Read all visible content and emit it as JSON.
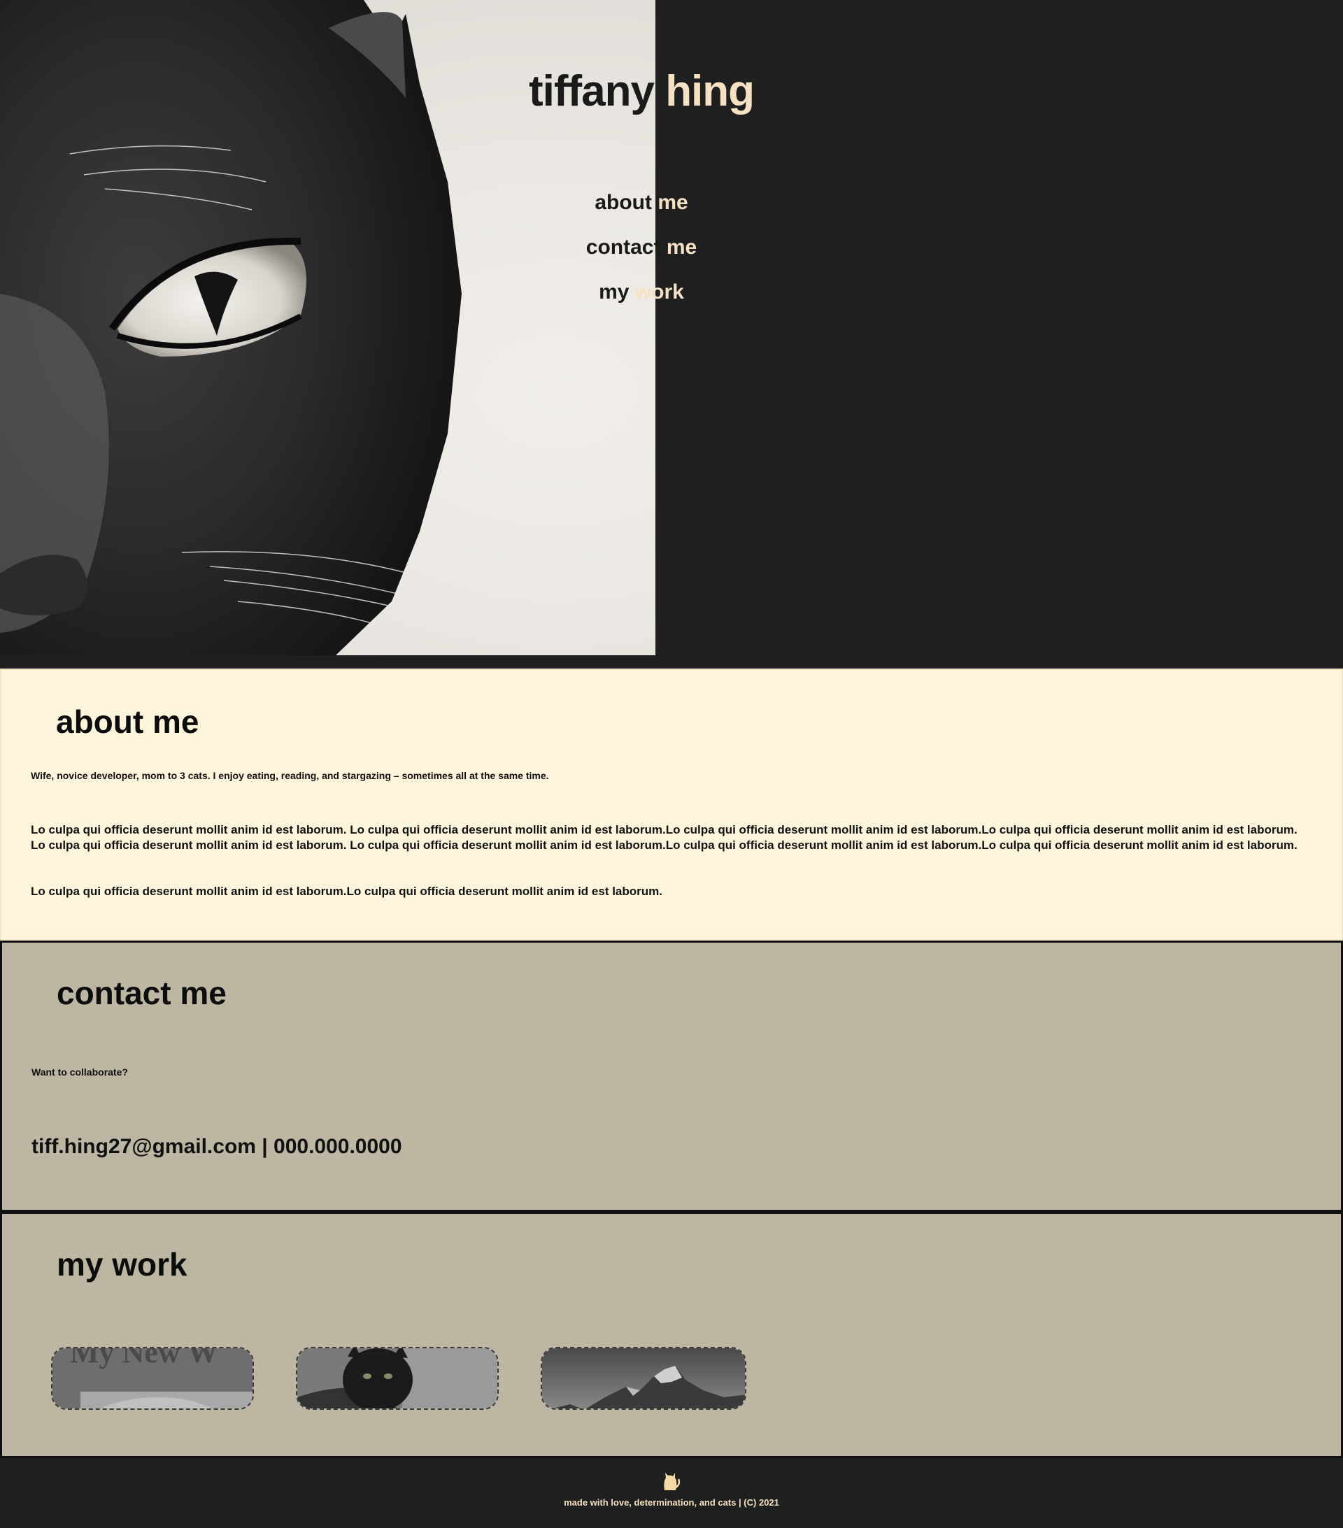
{
  "hero": {
    "title_first": "tiffany",
    "title_last": "hing",
    "nav": [
      {
        "first": "about",
        "second": "me"
      },
      {
        "first": "contact",
        "second": "me"
      },
      {
        "first": "my",
        "second": "work"
      }
    ]
  },
  "about": {
    "title": "about me",
    "intro": "Wife, novice developer, mom to 3 cats. I enjoy eating, reading, and stargazing – sometimes all at the same time.",
    "paragraph1": "Lo culpa qui officia deserunt mollit anim id est laborum. Lo culpa qui officia deserunt mollit anim id est laborum.Lo culpa qui officia deserunt mollit anim id est laborum.Lo culpa qui officia deserunt mollit anim id est laborum. Lo culpa qui officia deserunt mollit anim id est laborum. Lo culpa qui officia deserunt mollit anim id est laborum.Lo culpa qui officia deserunt mollit anim id est laborum.Lo culpa qui officia deserunt mollit anim id est laborum.",
    "paragraph2": "Lo culpa qui officia deserunt mollit anim id est laborum.Lo culpa qui officia deserunt mollit anim id est laborum."
  },
  "contact": {
    "title": "contact me",
    "prompt": "Want to collaborate?",
    "details": "tiff.hing27@gmail.com | 000.000.0000"
  },
  "work": {
    "title": "my work",
    "thumb1_text": "My New W"
  },
  "footer": {
    "text": "made with love, determination, and cats | (C) 2021"
  },
  "colors": {
    "dark_bg": "#1f1f1f",
    "accent_cream": "#f6e2c2",
    "about_bg": "#fdf5db",
    "section_bg": "#bdb6a2"
  }
}
